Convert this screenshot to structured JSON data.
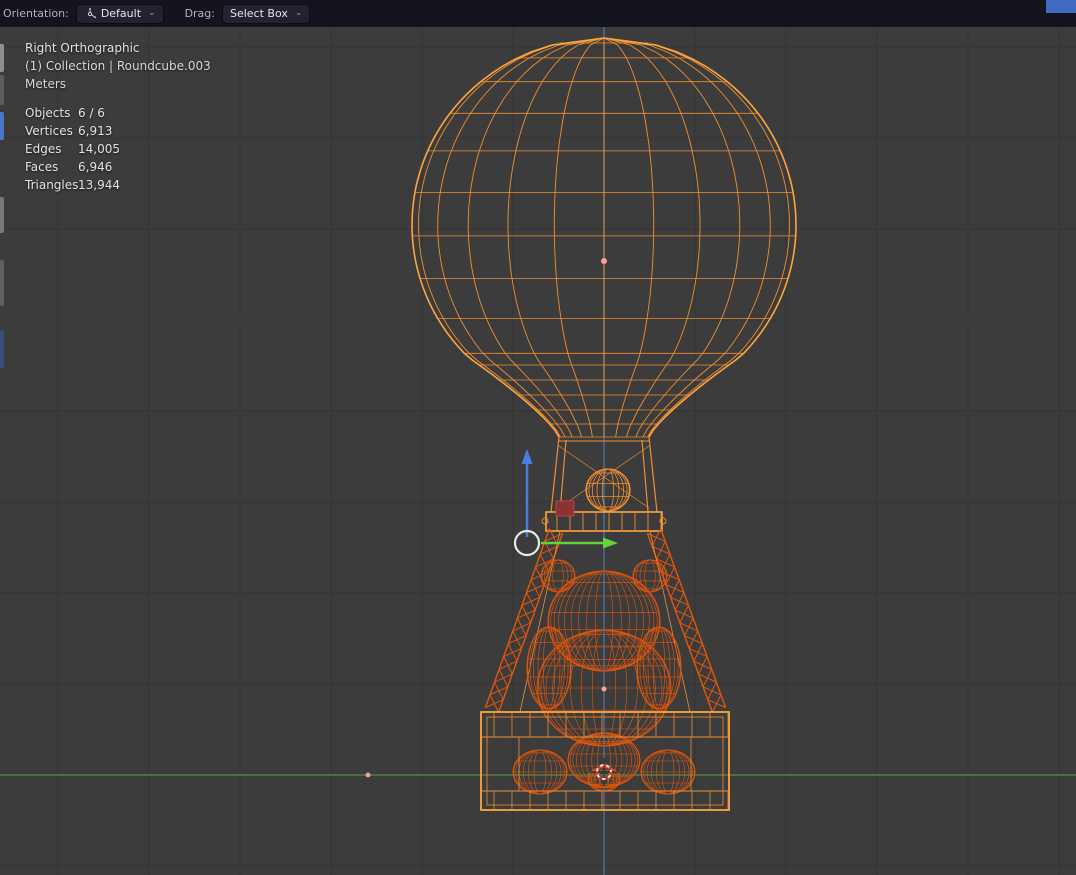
{
  "header": {
    "orientation": {
      "label": "Orientation:",
      "value": "Default"
    },
    "drag": {
      "label": "Drag:",
      "value": "Select Box"
    },
    "chevron": "⌄"
  },
  "viewport_info": {
    "view": "Right Orthographic",
    "breadcrumb": "(1) Collection | Roundcube.003",
    "units": "Meters",
    "stats": [
      {
        "label": "Objects",
        "value": "6 / 6"
      },
      {
        "label": "Vertices",
        "value": "6,913"
      },
      {
        "label": "Edges",
        "value": "14,005"
      },
      {
        "label": "Faces",
        "value": "6,946"
      },
      {
        "label": "Triangles",
        "value": "13,944"
      }
    ]
  },
  "scene": {
    "colors": {
      "background": "#3c3c3c",
      "grid": "#343434",
      "axis_z": "#54719e",
      "axis_y": "#5f8a3c",
      "wire_selected": "#ee8f31",
      "wire_outline": "#ffa53d",
      "wire_active": "#e4560b",
      "gizmo_z": "#4a7fe0",
      "gizmo_y": "#63d23d",
      "gizmo_free": "#e9e9e9",
      "cursor_red": "#cc3333",
      "face_highlight": "#8f3032",
      "origin_pink": "#ff9d9d"
    }
  }
}
